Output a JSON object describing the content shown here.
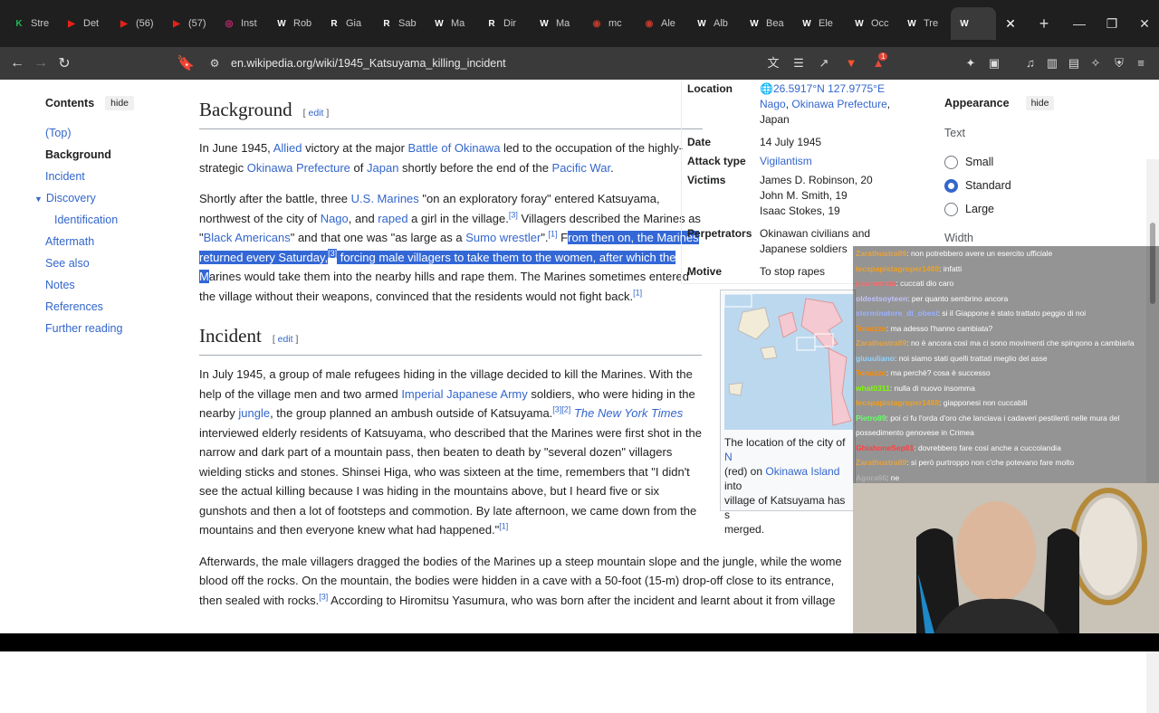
{
  "tabs": [
    {
      "label": "Stre",
      "fav": "K",
      "color": "#1fb955"
    },
    {
      "label": "Det",
      "fav": "▶",
      "color": "#e62117"
    },
    {
      "label": "(56)",
      "fav": "▶",
      "color": "#e62117"
    },
    {
      "label": "(57)",
      "fav": "▶",
      "color": "#e62117"
    },
    {
      "label": "Inst",
      "fav": "◎",
      "color": "#d62976"
    },
    {
      "label": "Rob",
      "fav": "W",
      "color": "#ffffff"
    },
    {
      "label": "Gia",
      "fav": "R",
      "color": "#ffffff"
    },
    {
      "label": "Sab",
      "fav": "R",
      "color": "#ffffff"
    },
    {
      "label": "Ma",
      "fav": "W",
      "color": "#ffffff"
    },
    {
      "label": "Dir",
      "fav": "R",
      "color": "#ffffff"
    },
    {
      "label": "Ma",
      "fav": "W",
      "color": "#ffffff"
    },
    {
      "label": "mc",
      "fav": "◉",
      "color": "#c0392b"
    },
    {
      "label": "Ale",
      "fav": "◉",
      "color": "#c0392b"
    },
    {
      "label": "Alb",
      "fav": "W",
      "color": "#ffffff"
    },
    {
      "label": "Bea",
      "fav": "W",
      "color": "#ffffff"
    },
    {
      "label": "Ele",
      "fav": "W",
      "color": "#ffffff"
    },
    {
      "label": "Occ",
      "fav": "W",
      "color": "#ffffff"
    },
    {
      "label": "Tre",
      "fav": "W",
      "color": "#ffffff"
    }
  ],
  "url": "en.wikipedia.org/wiki/1945_Katsuyama_killing_incident",
  "notification_count": "1",
  "toc": {
    "title": "Contents",
    "hide": "hide",
    "items": [
      "(Top)",
      "Background",
      "Incident",
      "Discovery",
      "Identification",
      "Aftermath",
      "See also",
      "Notes",
      "References",
      "Further reading"
    ]
  },
  "background": {
    "heading": "Background",
    "edit": "edit",
    "p1": {
      "a": "In June 1945, ",
      "l1": "Allied",
      "b": " victory at the major ",
      "l2": "Battle of Okinawa",
      "c": " led to the occupation of the highly-strategic ",
      "l3": "Okinawa Prefecture",
      "d": " of ",
      "l4": "Japan",
      "e": " shortly before the end of the ",
      "l5": "Pacific War",
      "f": "."
    },
    "p2": {
      "a": "Shortly after the battle, three ",
      "l1": "U.S. Marines",
      "b": " \"on an exploratory foray\" entered Katsuyama, northwest of the city of ",
      "l2": "Nago",
      "c": ", and ",
      "l3": "raped",
      "d": " a girl in the village.",
      "s1": "[3]",
      "e": " Villagers described the Marines as \"",
      "l4": "Black Americans",
      "f": "\" and that one was \"as large as a ",
      "l5": "Sumo wrestler",
      "g": "\".",
      "s2": "[1]",
      "h": " F",
      "hl1": "rom then on, the Marines returned every Saturday,",
      "s3": "[3]",
      "hl2": " forcing male villagers to take them to the women, after which the M",
      "i": "arines would take them into the nearby hills and rape them. The Marines sometimes entered the village without their weapons, convinced that the residents would not fight back.",
      "s4": "[1]"
    }
  },
  "incident": {
    "heading": "Incident",
    "edit": "edit",
    "p1": {
      "a": "In July 1945, a group of male refugees hiding in the village decided to kill the Marines. With the help of the village men and two armed ",
      "l1": "Imperial Japanese Army",
      "b": " soldiers, who were hiding in the nearby ",
      "l2": "jungle",
      "c": ", the group planned an ambush outside of Katsuyama.",
      "s1": "[3][2]",
      "d": " ",
      "l3": "The New York Times",
      "e": " interviewed elderly residents of Katsuyama, who described that the Marines were first shot in the narrow and dark part of a mountain pass, then beaten to death by \"several dozen\" villagers wielding sticks and stones. Shinsei Higa, who was sixteen at the time, remembers that \"I didn't see the actual killing because I was hiding in the mountains above, but I heard five or six gunshots and then a lot of footsteps and commotion. By late afternoon, we came down from the mountains and then everyone knew what had happened.\"",
      "s2": "[1]"
    },
    "p2": {
      "a": "Afterwards, the male villagers dragged the bodies of the Marines up a steep mountain slope and the jungle, while the wome",
      "b": "blood off the rocks. On the mountain, the bodies were hidden in a cave with a 50-foot (15-m) drop-off close to its entrance,",
      "c": "then sealed with rocks.",
      "s1": "[3]",
      "d": " According to Hiromitsu Yasumura, who was born after the incident and learnt about it from village"
    }
  },
  "infobox": {
    "location_label": "Location",
    "coords": "26.5917°N 127.9775°E",
    "loc_l1": "Nago",
    "loc_sep": ", ",
    "loc_l2": "Okinawa Prefecture",
    "loc_tail": ",",
    "loc_country": "Japan",
    "date_label": "Date",
    "date": "14 July 1945",
    "attack_label": "Attack type",
    "attack": "Vigilantism",
    "victims_label": "Victims",
    "victims": [
      "James D. Robinson, 20",
      "John M. Smith, 19",
      "Isaac Stokes, 19"
    ],
    "perp_label": "Perpetrators",
    "perp": "Okinawan civilians and Japanese soldiers",
    "motive_label": "Motive",
    "motive": "To stop rapes"
  },
  "map": {
    "cap_a": "The location of the city of ",
    "cap_l1": "N",
    "cap_b": "(red) on ",
    "cap_l2": "Okinawa Island",
    "cap_c": " into",
    "cap_d": "village of Katsuyama has s",
    "cap_e": "merged."
  },
  "appearance": {
    "title": "Appearance",
    "hide": "hide",
    "text_label": "Text",
    "options": [
      "Small",
      "Standard",
      "Large"
    ],
    "selected": "Standard",
    "width_label": "Width"
  },
  "chat": [
    {
      "user": "Zarathustra89",
      "msg": ": non potrebbero avere un esercito ufficiale",
      "color": "#e8a33d"
    },
    {
      "user": "lecapapistagroper1488",
      "msg": ": infatti",
      "color": "#f0a020"
    },
    {
      "user": "pawmerata",
      "msg": ": cuccati dio caro",
      "color": "#ff6b6b"
    },
    {
      "user": "oldestsoyteen",
      "msg": ": per quanto sembrino ancora",
      "color": "#c0c0ff"
    },
    {
      "user": "sterminatore_di_obesi",
      "msg": ": si il Giappone è stato trattato peggio di noi",
      "color": "#9bb0ff"
    },
    {
      "user": "Tonuzzo",
      "msg": ": ma adesso l'hanno cambiata?",
      "color": "#ff8c00"
    },
    {
      "user": "Zarathustra89",
      "msg": ": no è ancora così ma ci sono movimenti che spingono a cambiarla",
      "color": "#e8a33d"
    },
    {
      "user": "giuuuliano",
      "msg": ": noi siamo stati quelli trattati meglio del asse",
      "color": "#8fd3ff"
    },
    {
      "user": "Tonuzzo",
      "msg": ": ma perchè? cosa è successo",
      "color": "#ff8c00"
    },
    {
      "user": "what0311",
      "msg": ": nulla di nuovo insomma",
      "color": "#7cfc00"
    },
    {
      "user": "lecapapistagroper1488",
      "msg": ": giapponesi non cuccabili",
      "color": "#f0a020"
    },
    {
      "user": "Pietro89",
      "msg": ": poi ci fu l'orda d'oro che lanciava i cadaveri pestilenti nelle mura del",
      "color": "#66ff66"
    },
    {
      "user": "",
      "msg": "possedimento genovese in Crimea",
      "color": "#ffffff"
    },
    {
      "user": "GhiahoneSep01",
      "msg": ": dovrebbero fare così anche a cuccolandia",
      "color": "#ff4040"
    },
    {
      "user": "Zarathustra89",
      "msg": ": si però purtroppo non c'che potevano fare molto",
      "color": "#e8a33d"
    },
    {
      "user": "Agora66",
      "msg": ": ne",
      "color": "#b0b0b0"
    }
  ]
}
